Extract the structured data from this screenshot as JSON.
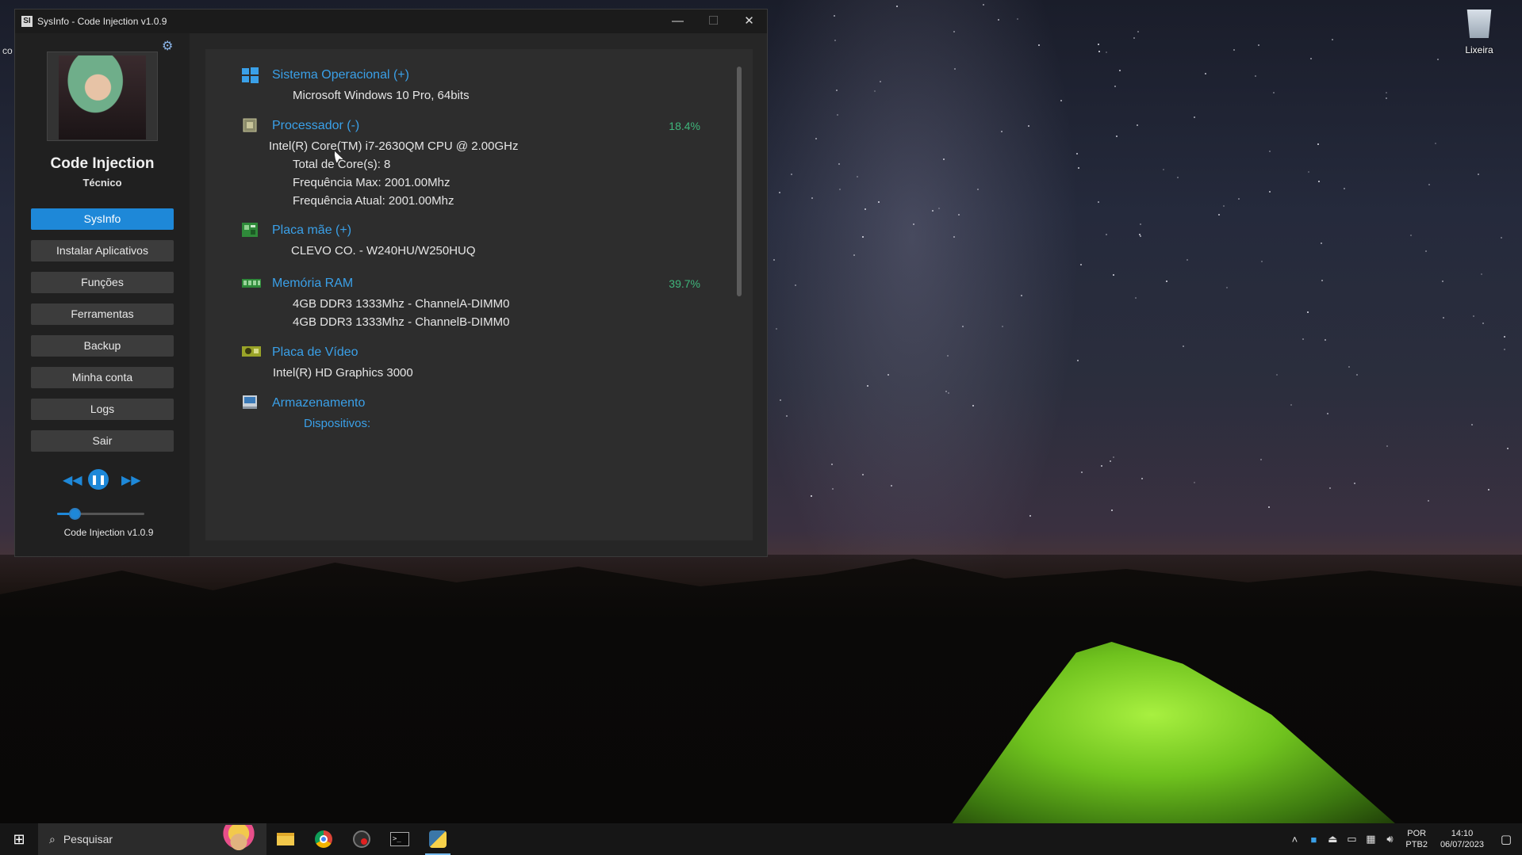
{
  "window": {
    "title": "SysInfo - Code Injection v1.0.9",
    "app_icon_glyph": "SI",
    "controls": {
      "minimize": "—",
      "maximize": "☐",
      "close": "✕"
    }
  },
  "sidebar": {
    "profile_name": "Code Injection",
    "profile_role": "Técnico",
    "settings_icon": "gear-icon",
    "nav": [
      {
        "label": "SysInfo",
        "active": true
      },
      {
        "label": "Instalar Aplicativos"
      },
      {
        "label": "Funções"
      },
      {
        "label": "Ferramentas"
      },
      {
        "label": "Backup"
      },
      {
        "label": "Minha conta"
      },
      {
        "label": "Logs"
      },
      {
        "label": "Sair"
      }
    ],
    "player": {
      "prev": "◀◀",
      "pause": "❚❚",
      "next": "▶▶",
      "volume_fraction": 0.2
    },
    "version": "Code Injection v1.0.9"
  },
  "sysinfo": {
    "os": {
      "title": "Sistema Operacional (+)",
      "value": "Microsoft Windows 10 Pro, 64bits"
    },
    "cpu": {
      "title": "Processador (-)",
      "percent": "18.4%",
      "model": "Intel(R) Core(TM) i7-2630QM CPU @ 2.00GHz",
      "cores": "Total de Core(s): 8",
      "freq_max": "Frequência Max: 2001.00Mhz",
      "freq_current": "Frequência Atual: 2001.00Mhz"
    },
    "board": {
      "title": "Placa mãe (+)",
      "value": "CLEVO CO.  - W240HU/W250HUQ"
    },
    "ram": {
      "title": "Memória RAM",
      "percent": "39.7%",
      "modules": [
        "4GB DDR3 1333Mhz - ChannelA-DIMM0",
        "4GB DDR3 1333Mhz - ChannelB-DIMM0"
      ]
    },
    "gpu": {
      "title": "Placa de Vídeo",
      "value": "Intel(R) HD Graphics 3000"
    },
    "storage": {
      "title": "Armazenamento",
      "devices_label": "Dispositivos:"
    }
  },
  "desktop": {
    "recycle_bin_label": "Lixeira",
    "cut_label": "co"
  },
  "taskbar": {
    "search_placeholder": "Pesquisar",
    "lang_top": "POR",
    "lang_bottom": "PTB2",
    "time": "14:10",
    "date": "06/07/2023",
    "tray_icons": [
      "chevron-up-icon",
      "app-tray-icon",
      "usb-icon",
      "battery-icon",
      "network-icon",
      "volume-icon"
    ]
  },
  "colors": {
    "accent": "#1e88d8",
    "section_title": "#3aa0e8",
    "percent": "#3fb57b"
  }
}
